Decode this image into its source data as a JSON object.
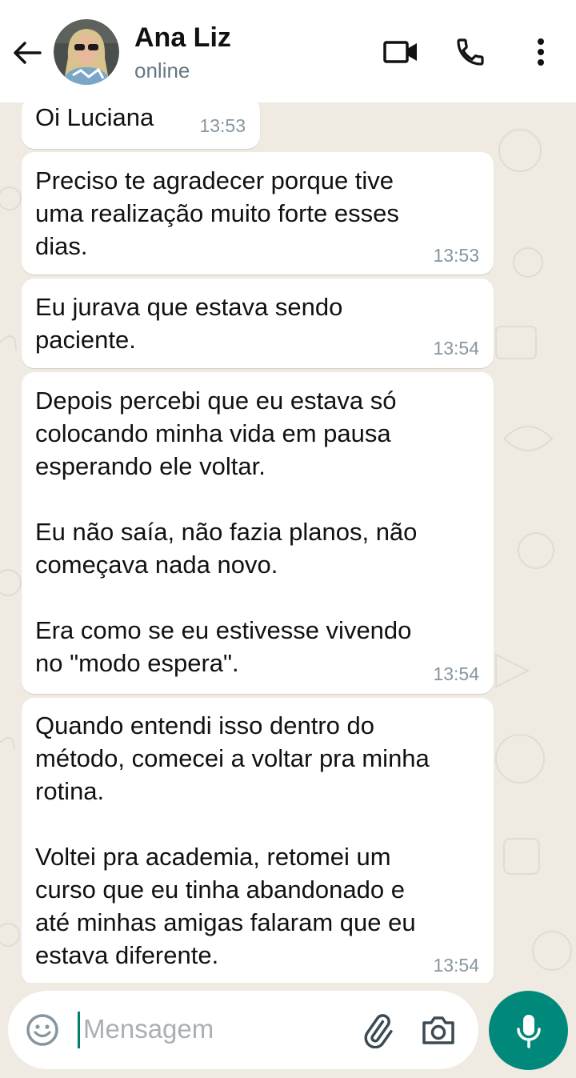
{
  "header": {
    "contact_name": "Ana Liz",
    "status": "online",
    "icons": [
      "back-arrow-icon",
      "video-call-icon",
      "phone-icon",
      "more-options-icon"
    ]
  },
  "messages": [
    {
      "text": "Oi Luciana",
      "time": "13:53"
    },
    {
      "text": "Preciso te agradecer porque tive\numa realização muito forte esses\ndias.",
      "time": "13:53"
    },
    {
      "text": "Eu jurava que estava sendo\npaciente.",
      "time": "13:54"
    },
    {
      "text": "Depois percebi que eu estava só\ncolocando minha vida em pausa\nesperando ele voltar.\n\nEu não saía, não fazia planos, não\ncomeçava nada novo.\n\nEra como se eu estivesse vivendo\nno \"modo espera\".",
      "time": "13:54"
    },
    {
      "text": "Quando entendi isso dentro do\nmétodo, comecei a voltar pra minha\nrotina.\n\nVoltei pra academia, retomei um\ncurso que eu tinha abandonado e\naté minhas amigas falaram que eu\nestava diferente.",
      "time": "13:54"
    }
  ],
  "composer": {
    "placeholder": "Mensagem",
    "icons": [
      "emoji-icon",
      "attach-icon",
      "camera-icon",
      "mic-icon"
    ]
  },
  "colors": {
    "header_bg": "#ffffff",
    "chat_bg": "#efeae2",
    "bubble_bg": "#ffffff",
    "accent": "#00897b",
    "time_text": "#8696a0"
  }
}
